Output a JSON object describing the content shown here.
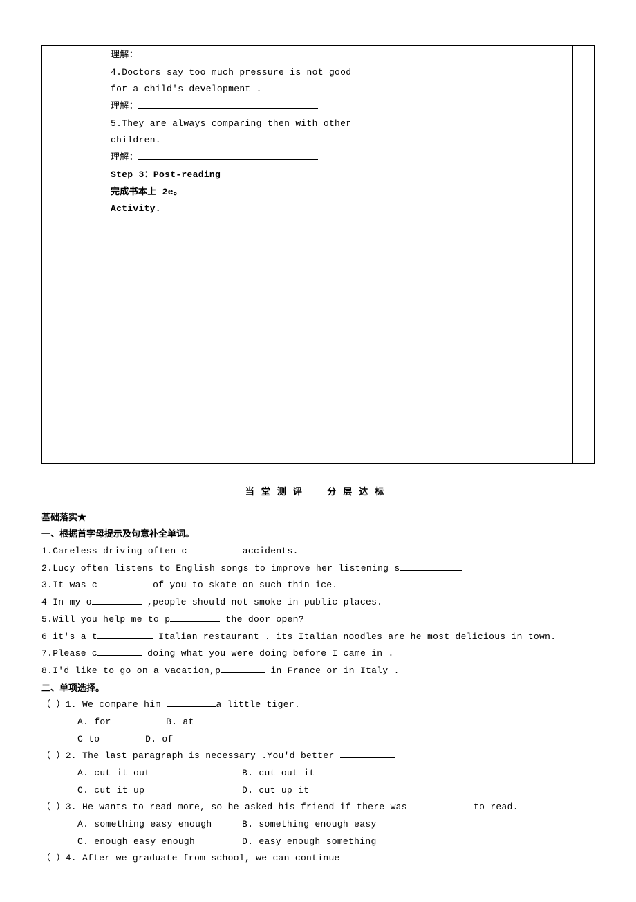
{
  "box": {
    "lixie_prefix": "理解：",
    "s4": "4.Doctors say too much pressure is not good for a child's development .",
    "s5": "5.They are always comparing then with other children.",
    "step3": "Step 3：Post-reading",
    "finish": "完成书本上 2e。",
    "activity": "Activity."
  },
  "section_title_left": "当堂测评",
  "section_title_right": "分层达标",
  "basics_label": "基础落实★",
  "partA_title": "一、根据首字母提示及句意补全单词。",
  "A": {
    "q1a": "1.Careless driving often c",
    "q1b": " accidents.",
    "q2a": "2.Lucy often listens to English songs to improve her listening s",
    "q3a": "3.It was c",
    "q3b": " of you to skate on such thin ice.",
    "q4a": "4 In my o",
    "q4b": " ,people should not smoke in public places.",
    "q5a": "5.Will you help me to p",
    "q5b": " the door open?",
    "q6a": "6 it's a t",
    "q6b": " Italian restaurant . its Italian noodles are he most delicious in town.",
    "q7a": "7.Please c",
    "q7b": " doing what you were doing before I came in .",
    "q8a": "8.I'd like to go on a vacation,p",
    "q8b": " in France or in Italy ."
  },
  "partB_title": "二、单项选择。",
  "B": {
    "q1": "（ ）1. We compare him ",
    "q1_after": "a little tiger.",
    "q1a": "A. for",
    "q1b": "B. at",
    "q1c": "C  to",
    "q1d": "D. of",
    "q2": "（ ）2. The last paragraph is necessary .You'd better ",
    "q2a": "A. cut it out",
    "q2b": "B. cut out it",
    "q2c": "C. cut it up",
    "q2d": "D. cut up it",
    "q3": "（ ）3. He wants to read more, so he asked his friend if there was ",
    "q3_after": "to read.",
    "q3a": "A. something easy enough",
    "q3b": "B. something enough easy",
    "q3c": "C. enough easy enough",
    "q3d": "D. easy enough something",
    "q4": "（ ）4. After we graduate from school, we can continue "
  }
}
